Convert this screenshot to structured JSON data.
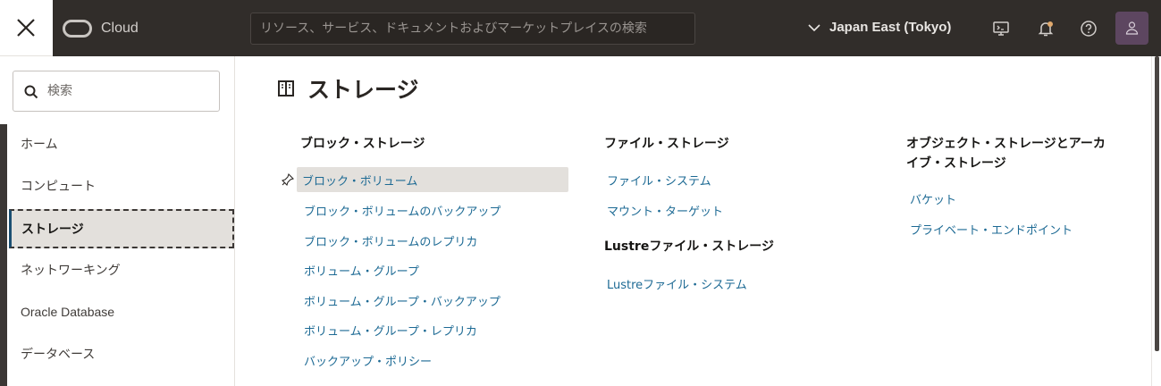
{
  "header": {
    "logo_text": "Cloud",
    "search_placeholder": "リソース、サービス、ドキュメントおよびマーケットプレイスの検索",
    "region": "Japan East (Tokyo)",
    "icons": [
      "close-icon",
      "cloud-logo-icon",
      "chevron-down-icon",
      "cloud-shell-icon",
      "bell-icon",
      "help-icon",
      "user-icon"
    ]
  },
  "sidebar": {
    "search_placeholder": "検索",
    "items": [
      {
        "label": "ホーム"
      },
      {
        "label": "コンピュート"
      },
      {
        "label": "ストレージ",
        "active": true
      },
      {
        "label": "ネットワーキング"
      },
      {
        "label": "Oracle Database"
      },
      {
        "label": "データベース"
      }
    ]
  },
  "main": {
    "title": "ストレージ",
    "columns": [
      {
        "heading": "ブロック・ストレージ",
        "links": [
          "ブロック・ボリューム",
          "ブロック・ボリュームのバックアップ",
          "ブロック・ボリュームのレプリカ",
          "ボリューム・グループ",
          "ボリューム・グループ・バックアップ",
          "ボリューム・グループ・レプリカ",
          "バックアップ・ポリシー"
        ]
      },
      {
        "heading": "ファイル・ストレージ",
        "links": [
          "ファイル・システム",
          "マウント・ターゲット"
        ],
        "heading2": "Lustreファイル・ストレージ",
        "links2": [
          "Lustreファイル・システム"
        ]
      },
      {
        "heading_line1": "オブジェクト・ストレージとアーカ",
        "heading_line2": "イブ・ストレージ",
        "links": [
          "バケット",
          "プライベート・エンドポイント"
        ]
      }
    ]
  },
  "colors": {
    "header_bg": "#312d2a",
    "link": "#1d6a94",
    "active_bg": "#e3e0dc"
  }
}
